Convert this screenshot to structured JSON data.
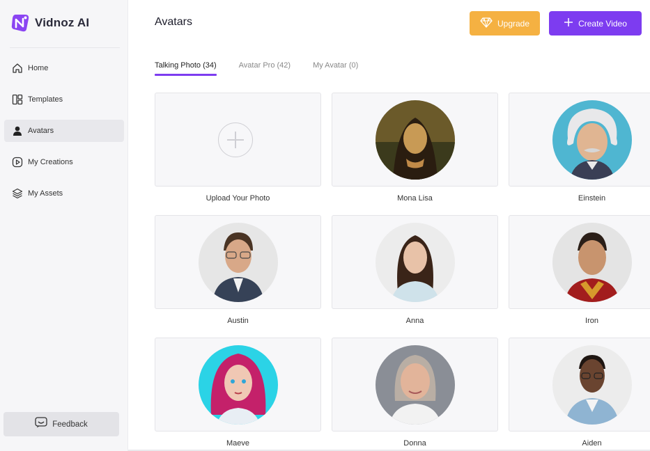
{
  "app": {
    "name": "Vidnoz AI",
    "brand_color": "#7d3cf0",
    "upgrade_color": "#f5b142"
  },
  "sidebar": {
    "items": [
      {
        "label": "Home",
        "icon": "home-icon",
        "active": false
      },
      {
        "label": "Templates",
        "icon": "templates-icon",
        "active": false
      },
      {
        "label": "Avatars",
        "icon": "user-icon",
        "active": true
      },
      {
        "label": "My Creations",
        "icon": "play-circle-icon",
        "active": false
      },
      {
        "label": "My Assets",
        "icon": "layers-icon",
        "active": false
      }
    ],
    "feedback_label": "Feedback"
  },
  "header": {
    "title": "Avatars",
    "upgrade_label": "Upgrade",
    "create_label": "Create Video"
  },
  "tabs": [
    {
      "label": "Talking Photo (34)",
      "active": true
    },
    {
      "label": "Avatar Pro (42)",
      "active": false
    },
    {
      "label": "My Avatar (0)",
      "active": false
    }
  ],
  "avatars": [
    {
      "name": "Upload Your Photo",
      "kind": "upload"
    },
    {
      "name": "Mona Lisa"
    },
    {
      "name": "Einstein"
    },
    {
      "name": "Austin"
    },
    {
      "name": "Anna"
    },
    {
      "name": "Iron"
    },
    {
      "name": "Maeve"
    },
    {
      "name": "Donna"
    },
    {
      "name": "Aiden"
    }
  ]
}
